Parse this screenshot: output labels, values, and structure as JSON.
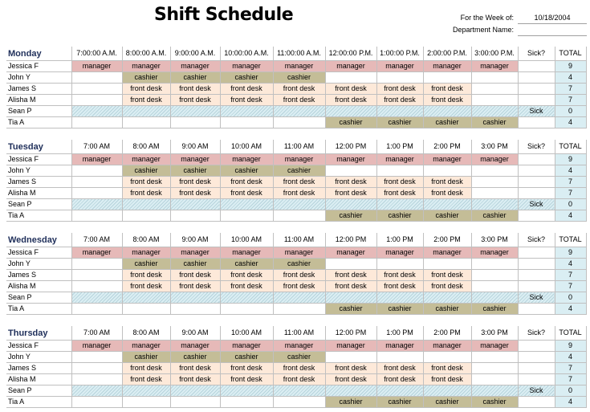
{
  "title": "Shift Schedule",
  "meta": {
    "week_label": "For the Week of:",
    "week_value": "10/18/2004",
    "dept_label": "Department Name:",
    "dept_value": ""
  },
  "colors": {
    "manager": "#e6b9b8",
    "cashier": "#c4bd97",
    "front desk": "#fde9d9",
    "total": "#daeef3",
    "sick": "#dbeef3"
  },
  "sick_header": "Sick?",
  "total_header": "TOTAL",
  "days": [
    {
      "name": "Monday",
      "times": [
        "7:00:00 A.M.",
        "8:00:00 A.M.",
        "9:00:00 A.M.",
        "10:00:00 A.M.",
        "11:00:00 A.M.",
        "12:00:00 P.M.",
        "1:00:00 P.M.",
        "2:00:00 P.M.",
        "3:00:00 P.M."
      ]
    },
    {
      "name": "Tuesday",
      "times": [
        "7:00 AM",
        "8:00 AM",
        "9:00 AM",
        "10:00 AM",
        "11:00 AM",
        "12:00 PM",
        "1:00 PM",
        "2:00 PM",
        "3:00 PM"
      ]
    },
    {
      "name": "Wednesday",
      "times": [
        "7:00 AM",
        "8:00 AM",
        "9:00 AM",
        "10:00 AM",
        "11:00 AM",
        "12:00 PM",
        "1:00 PM",
        "2:00 PM",
        "3:00 PM"
      ]
    },
    {
      "name": "Thursday",
      "times": [
        "7:00 AM",
        "8:00 AM",
        "9:00 AM",
        "10:00 AM",
        "11:00 AM",
        "12:00 PM",
        "1:00 PM",
        "2:00 PM",
        "3:00 PM"
      ]
    }
  ],
  "employees": [
    {
      "name": "Jessica F",
      "shifts": [
        "manager",
        "manager",
        "manager",
        "manager",
        "manager",
        "manager",
        "manager",
        "manager",
        "manager"
      ],
      "sick": "",
      "total": "9"
    },
    {
      "name": "John Y",
      "shifts": [
        "",
        "cashier",
        "cashier",
        "cashier",
        "cashier",
        "",
        "",
        "",
        ""
      ],
      "sick": "",
      "total": "4"
    },
    {
      "name": "James S",
      "shifts": [
        "",
        "front desk",
        "front desk",
        "front desk",
        "front desk",
        "front desk",
        "front desk",
        "front desk",
        ""
      ],
      "sick": "",
      "total": "7"
    },
    {
      "name": "Alisha M",
      "shifts": [
        "",
        "front desk",
        "front desk",
        "front desk",
        "front desk",
        "front desk",
        "front desk",
        "front desk",
        ""
      ],
      "sick": "",
      "total": "7"
    },
    {
      "name": "Sean P",
      "shifts": [
        "",
        "",
        "",
        "",
        "",
        "",
        "",
        "",
        ""
      ],
      "sick": "Sick",
      "total": "0",
      "is_sick": true
    },
    {
      "name": "Tia A",
      "shifts": [
        "",
        "",
        "",
        "",
        "",
        "cashier",
        "cashier",
        "cashier",
        "cashier"
      ],
      "sick": "",
      "total": "4"
    }
  ]
}
